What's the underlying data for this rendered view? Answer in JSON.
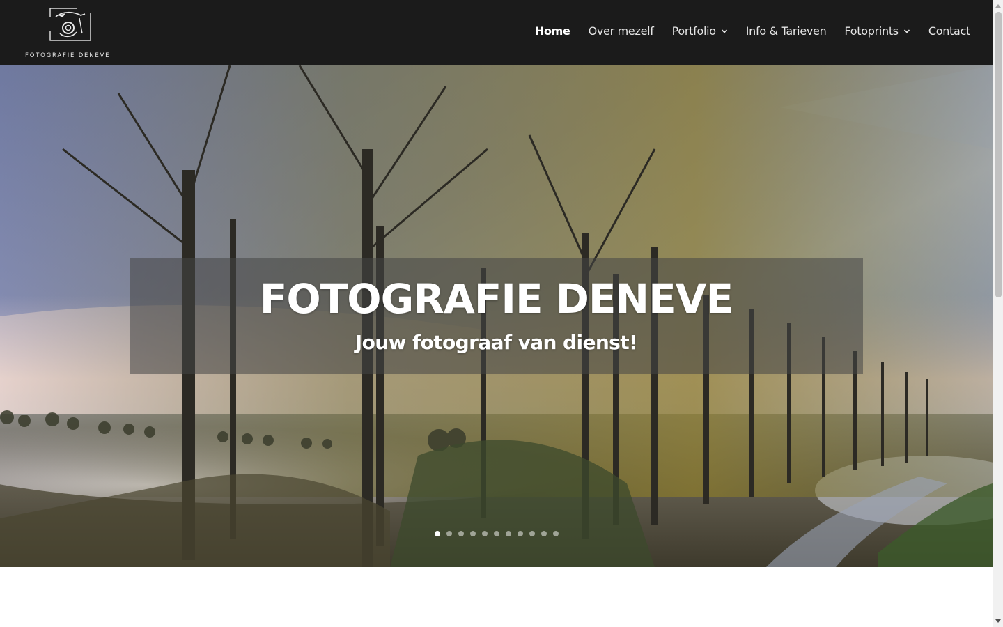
{
  "header": {
    "logo_text": "FOTOGRAFIE DENEVE",
    "background_color": "#1b1b1b"
  },
  "nav": {
    "items": [
      {
        "label": "Home",
        "active": true,
        "has_dropdown": false
      },
      {
        "label": "Over mezelf",
        "active": false,
        "has_dropdown": false
      },
      {
        "label": "Portfolio",
        "active": false,
        "has_dropdown": true
      },
      {
        "label": "Info & Tarieven",
        "active": false,
        "has_dropdown": false
      },
      {
        "label": "Fotoprints",
        "active": false,
        "has_dropdown": true
      },
      {
        "label": "Contact",
        "active": false,
        "has_dropdown": false
      }
    ]
  },
  "hero": {
    "title": "FOTOGRAFIE DENEVE",
    "subtitle": "Jouw fotograaf van dienst!",
    "slide_count": 11,
    "active_slide": 1,
    "image_description_icon": "landscape-photo"
  }
}
